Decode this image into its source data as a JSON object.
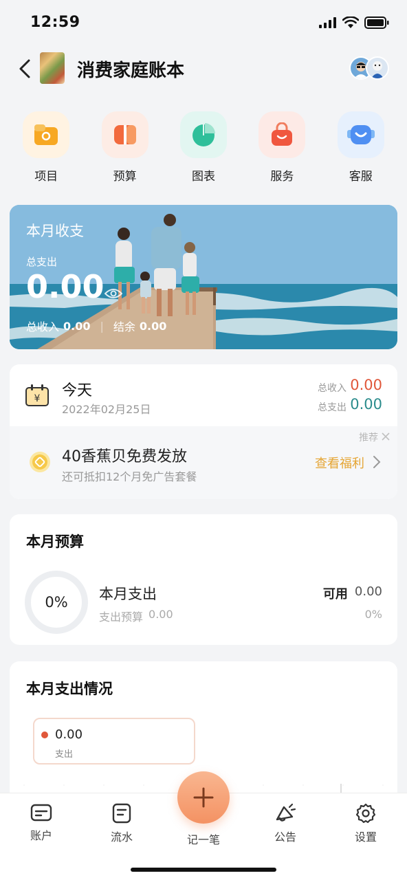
{
  "status": {
    "time": "12:59"
  },
  "header": {
    "title": "消费家庭账本"
  },
  "quick_menu": [
    {
      "label": "项目",
      "icon": "folder-icon"
    },
    {
      "label": "预算",
      "icon": "budget-icon"
    },
    {
      "label": "图表",
      "icon": "pie-chart-icon"
    },
    {
      "label": "服务",
      "icon": "shopping-bag-icon"
    },
    {
      "label": "客服",
      "icon": "robot-icon"
    }
  ],
  "banner": {
    "title": "本月收支",
    "expense_label": "总支出",
    "expense_value": "0.00",
    "income_label": "总收入",
    "income_value": "0.00",
    "separator": "|",
    "balance_label": "结余",
    "balance_value": "0.00"
  },
  "today": {
    "title": "今天",
    "date": "2022年02月25日",
    "income_label": "总收入",
    "income_value": "0.00",
    "expense_label": "总支出",
    "expense_value": "0.00",
    "income_color": "#e0573a",
    "expense_color": "#2b8c8c"
  },
  "promo": {
    "tag": "推荐",
    "title": "40香蕉贝免费发放",
    "subtitle": "还可抵扣12个月免广告套餐",
    "action": "查看福利"
  },
  "budget": {
    "title": "本月预算",
    "ring_percent": "0%",
    "name": "本月支出",
    "sub_label": "支出预算",
    "sub_value": "0.00",
    "available_label": "可用",
    "available_value": "0.00",
    "available_percent": "0%"
  },
  "spending": {
    "title": "本月支出情况",
    "value": "0.00",
    "label": "支出",
    "dot_color": "#e0573a"
  },
  "tabs": [
    {
      "label": "账户",
      "icon": "card-icon"
    },
    {
      "label": "流水",
      "icon": "receipt-icon"
    },
    {
      "label": "记一笔",
      "icon": "plus-icon"
    },
    {
      "label": "公告",
      "icon": "megaphone-icon"
    },
    {
      "label": "设置",
      "icon": "gear-icon"
    }
  ],
  "colors": {
    "accent": "#f49263",
    "action": "#e5a534"
  }
}
